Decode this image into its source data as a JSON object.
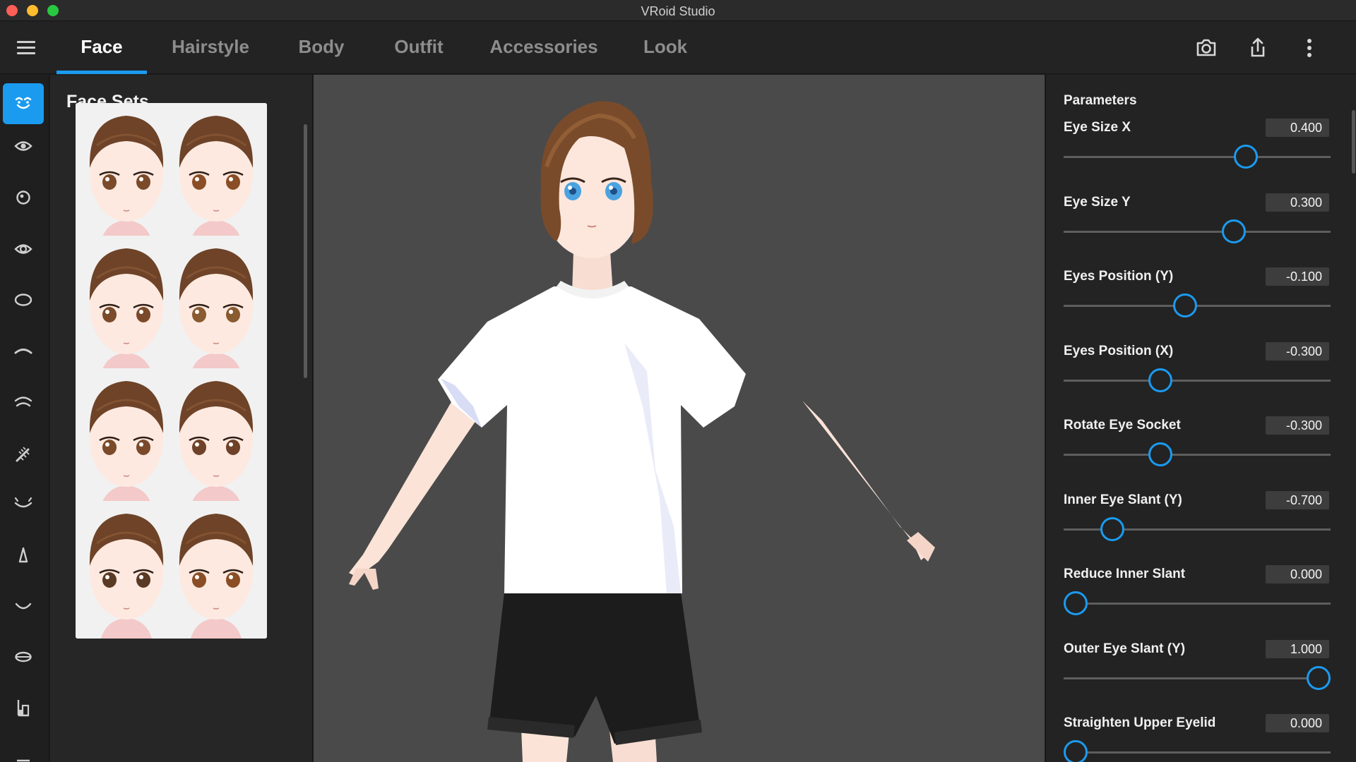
{
  "window": {
    "title": "VRoid Studio"
  },
  "nav": {
    "tabs": [
      {
        "label": "Face",
        "active": true
      },
      {
        "label": "Hairstyle",
        "active": false
      },
      {
        "label": "Body",
        "active": false
      },
      {
        "label": "Outfit",
        "active": false
      },
      {
        "label": "Accessories",
        "active": false
      },
      {
        "label": "Look",
        "active": false
      }
    ],
    "icons": [
      "camera-icon",
      "export-icon",
      "more-vertical-icon"
    ]
  },
  "rail": {
    "items": [
      "face-set-icon",
      "eye-icon",
      "iris-icon",
      "eye-highlight-icon",
      "eye-white-icon",
      "eyeline-icon",
      "eyebrow-icon",
      "eyelash-icon",
      "eyelid-icon",
      "nose-icon",
      "mouth-icon",
      "lips-icon",
      "body-shape-icon",
      "more-icon"
    ],
    "active_index": 0
  },
  "face_sets": {
    "title": "Face Sets",
    "items": [
      {
        "eye_color": "#7a4a2a",
        "checked": true
      },
      {
        "eye_color": "#8a4d25",
        "checked": true
      },
      {
        "eye_color": "#7a4a2a",
        "checked": true
      },
      {
        "eye_color": "#8a5a30",
        "checked": true
      },
      {
        "eye_color": "#7a4a2a",
        "checked": true
      },
      {
        "eye_color": "#6e4228",
        "checked": true
      },
      {
        "eye_color": "#5a3a24",
        "checked": false
      },
      {
        "eye_color": "#8a4d25",
        "checked": false
      }
    ]
  },
  "params": {
    "title": "Parameters",
    "items": [
      {
        "label": "Eye Size X",
        "value": "0.400",
        "fraction": 0.7
      },
      {
        "label": "Eye Size Y",
        "value": "0.300",
        "fraction": 0.65
      },
      {
        "label": "Eyes Position (Y)",
        "value": "-0.100",
        "fraction": 0.45
      },
      {
        "label": "Eyes Position (X)",
        "value": "-0.300",
        "fraction": 0.35
      },
      {
        "label": "Rotate Eye Socket",
        "value": "-0.300",
        "fraction": 0.35
      },
      {
        "label": "Inner Eye Slant (Y)",
        "value": "-0.700",
        "fraction": 0.15
      },
      {
        "label": "Reduce Inner Slant",
        "value": "0.000",
        "fraction": 0.0
      },
      {
        "label": "Outer Eye Slant (Y)",
        "value": "1.000",
        "fraction": 1.0
      },
      {
        "label": "Straighten Upper Eyelid",
        "value": "0.000",
        "fraction": 0.0
      }
    ]
  },
  "colors": {
    "accent": "#1a9bf0",
    "viewport_bg": "#4a4a4a",
    "hair": "#7a4b2a",
    "shirt": "#ffffff",
    "shorts": "#1c1c1c",
    "skin": "#fbe3d8",
    "avatar_eyes": "#4aa3e0"
  }
}
